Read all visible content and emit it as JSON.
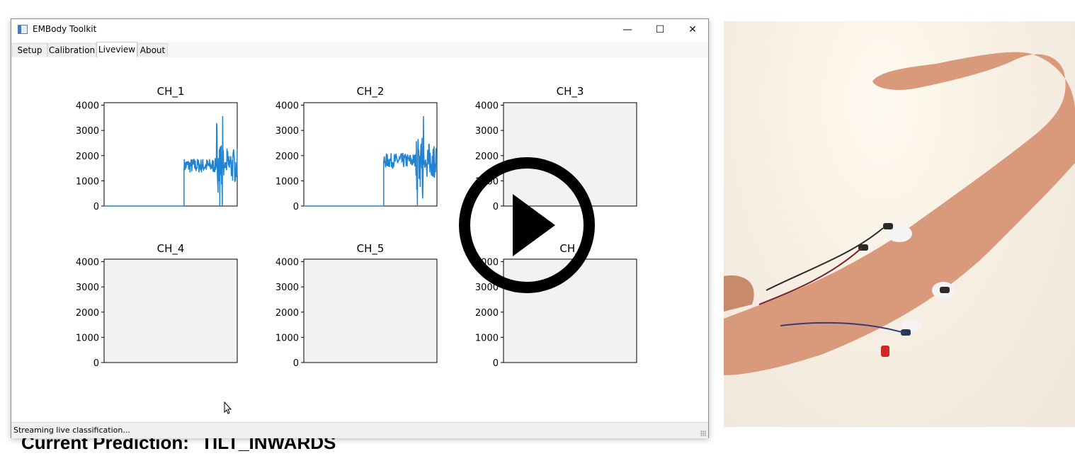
{
  "window": {
    "title": "EMBody Toolkit",
    "controls": {
      "minimize": "—",
      "maximize": "☐",
      "close": "✕"
    }
  },
  "tabs": [
    {
      "label": "Setup"
    },
    {
      "label": "Calibration"
    },
    {
      "label": "Liveview",
      "active": true
    },
    {
      "label": "About"
    }
  ],
  "chart_data": [
    {
      "type": "line",
      "title": "CH_1",
      "yticks": [
        "4000",
        "3000",
        "2000",
        "1000",
        "0"
      ],
      "ylim": [
        0,
        4100
      ],
      "has_signal": true,
      "description_values": {
        "baseline": 0,
        "active_level": 1600,
        "start_fraction": 0.6
      }
    },
    {
      "type": "line",
      "title": "CH_2",
      "yticks": [
        "4000",
        "3000",
        "2000",
        "1000",
        "0"
      ],
      "ylim": [
        0,
        4100
      ],
      "has_signal": true,
      "description_values": {
        "baseline": 0,
        "active_level": 1800,
        "start_fraction": 0.6
      }
    },
    {
      "type": "line",
      "title": "CH_3",
      "yticks": [
        "4000",
        "3000",
        "2000",
        "1000",
        "0"
      ],
      "ylim": [
        0,
        4100
      ],
      "has_signal": false
    },
    {
      "type": "line",
      "title": "CH_4",
      "yticks": [
        "4000",
        "3000",
        "2000",
        "1000",
        "0"
      ],
      "ylim": [
        0,
        4100
      ],
      "has_signal": false
    },
    {
      "type": "line",
      "title": "CH_5",
      "yticks": [
        "4000",
        "3000",
        "2000",
        "1000",
        "0"
      ],
      "ylim": [
        0,
        4100
      ],
      "has_signal": false
    },
    {
      "type": "line",
      "title": "CH_",
      "yticks": [
        "4000",
        "3000",
        "2000",
        "1000",
        "0"
      ],
      "ylim": [
        0,
        4100
      ],
      "has_signal": false
    }
  ],
  "prediction": {
    "label": "Current Prediction:",
    "value": "TILT_INWARDS"
  },
  "status": {
    "text": "Streaming live classification..."
  },
  "colors": {
    "series": "#1f84d1",
    "plot_bg": "#f2f2f2",
    "accent": "#000000"
  },
  "icons": {
    "play": "play-icon",
    "app": "app-icon",
    "cursor": "mouse-cursor-icon"
  }
}
